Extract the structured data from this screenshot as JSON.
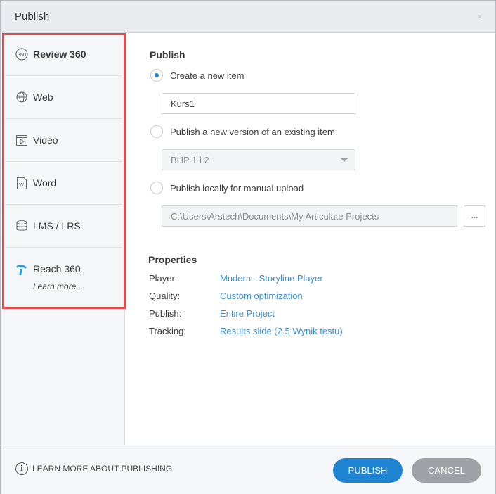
{
  "window": {
    "title": "Publish",
    "close_glyph": "×"
  },
  "sidebar": {
    "items": [
      {
        "id": "review360",
        "label": "Review 360",
        "icon": "review-360-icon",
        "active": true
      },
      {
        "id": "web",
        "label": "Web",
        "icon": "globe-icon",
        "active": false
      },
      {
        "id": "video",
        "label": "Video",
        "icon": "video-icon",
        "active": false
      },
      {
        "id": "word",
        "label": "Word",
        "icon": "word-document-icon",
        "active": false
      },
      {
        "id": "lms",
        "label": "LMS / LRS",
        "icon": "database-icon",
        "active": false
      },
      {
        "id": "reach360",
        "label": "Reach 360",
        "sub": "Learn more...",
        "icon": "reach-360-icon",
        "active": false
      }
    ]
  },
  "publish": {
    "heading": "Publish",
    "option_new": "Create a new item",
    "new_item_value": "Kurs1",
    "option_version": "Publish a new version of an existing item",
    "existing_item_value": "BHP 1 i 2",
    "option_local": "Publish locally for manual upload",
    "local_path": "C:\\Users\\Arstech\\Documents\\My Articulate Projects",
    "browse_label": "...",
    "selected": "new"
  },
  "properties": {
    "heading": "Properties",
    "rows": [
      {
        "label": "Player:",
        "value": "Modern - Storyline Player"
      },
      {
        "label": "Quality:",
        "value": "Custom optimization"
      },
      {
        "label": "Publish:",
        "value": "Entire Project"
      },
      {
        "label": "Tracking:",
        "value": "Results slide (2.5 Wynik testu)"
      }
    ]
  },
  "footer": {
    "learn_more": "LEARN MORE ABOUT PUBLISHING",
    "info_glyph": "i",
    "publish_label": "PUBLISH",
    "cancel_label": "CANCEL"
  },
  "colors": {
    "accent": "#1e84d1",
    "link": "#3c8fd0",
    "highlight": "#e8484c",
    "cancel": "#9ea2a6"
  }
}
